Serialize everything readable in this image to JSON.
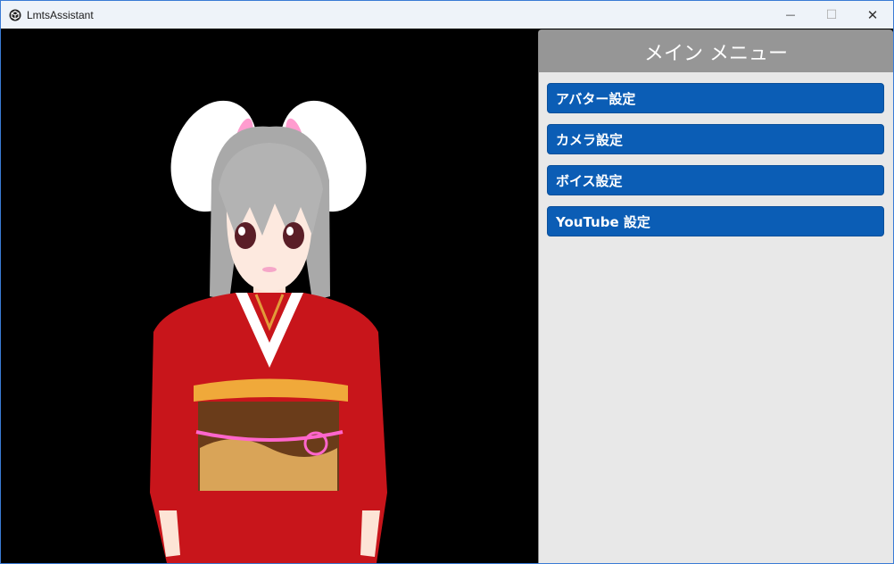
{
  "window": {
    "title": "LmtsAssistant",
    "controls": {
      "minimize": "—",
      "maximize": "☐",
      "close": "✕"
    }
  },
  "menu": {
    "title": "メイン メニュー",
    "items": [
      {
        "label": "アバター設定"
      },
      {
        "label": "カメラ設定"
      },
      {
        "label": "ボイス設定"
      },
      {
        "label": "YouTube 設定"
      }
    ]
  },
  "colors": {
    "accent_button": "#0b5db5",
    "panel_background": "#e8e8e8",
    "header_background": "#969696",
    "viewport_background": "#000000",
    "titlebar_background": "#eef3f9"
  },
  "icons": [
    "app-logo-icon",
    "minimize-icon",
    "maximize-icon",
    "close-icon"
  ]
}
